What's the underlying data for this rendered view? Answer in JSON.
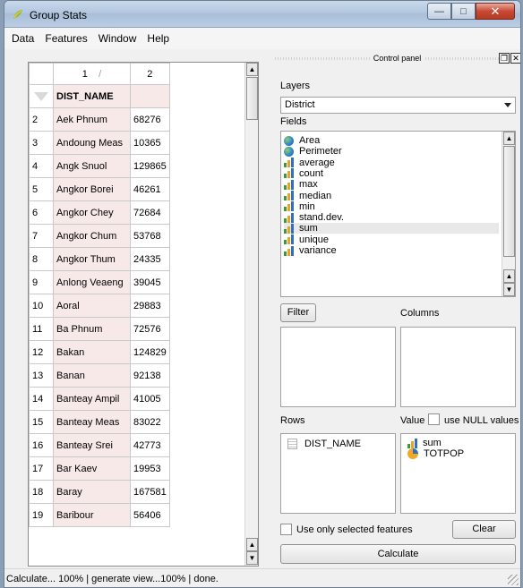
{
  "window": {
    "title": "Group Stats"
  },
  "menu": [
    "Data",
    "Features",
    "Window",
    "Help"
  ],
  "table": {
    "col_headers": [
      "1",
      "2"
    ],
    "field_header": "DIST_NAME",
    "rows": [
      {
        "n": "2",
        "name": "Aek Phnum",
        "value": "68276"
      },
      {
        "n": "3",
        "name": "Andoung Meas",
        "value": "10365"
      },
      {
        "n": "4",
        "name": "Angk Snuol",
        "value": "129865"
      },
      {
        "n": "5",
        "name": "Angkor Borei",
        "value": "46261"
      },
      {
        "n": "6",
        "name": "Angkor Chey",
        "value": "72684"
      },
      {
        "n": "7",
        "name": "Angkor Chum",
        "value": "53768"
      },
      {
        "n": "8",
        "name": "Angkor Thum",
        "value": "24335"
      },
      {
        "n": "9",
        "name": "Anlong Veaeng",
        "value": "39045"
      },
      {
        "n": "10",
        "name": "Aoral",
        "value": "29883"
      },
      {
        "n": "11",
        "name": "Ba Phnum",
        "value": "72576"
      },
      {
        "n": "12",
        "name": "Bakan",
        "value": "124829"
      },
      {
        "n": "13",
        "name": "Banan",
        "value": "92138"
      },
      {
        "n": "14",
        "name": "Banteay Ampil",
        "value": "41005"
      },
      {
        "n": "15",
        "name": "Banteay Meas",
        "value": "83022"
      },
      {
        "n": "16",
        "name": "Banteay Srei",
        "value": "42773"
      },
      {
        "n": "17",
        "name": "Bar Kaev",
        "value": "19953"
      },
      {
        "n": "18",
        "name": "Baray",
        "value": "167581"
      },
      {
        "n": "19",
        "name": "Baribour",
        "value": "56406"
      }
    ]
  },
  "panel": {
    "title": "Control panel",
    "layers_label": "Layers",
    "layer_value": "District",
    "fields_label": "Fields",
    "fields": [
      {
        "label": "Area",
        "icon": "globe"
      },
      {
        "label": "Perimeter",
        "icon": "globe"
      },
      {
        "label": "average",
        "icon": "bars"
      },
      {
        "label": "count",
        "icon": "bars"
      },
      {
        "label": "max",
        "icon": "bars"
      },
      {
        "label": "median",
        "icon": "bars"
      },
      {
        "label": "min",
        "icon": "bars"
      },
      {
        "label": "stand.dev.",
        "icon": "bars"
      },
      {
        "label": "sum",
        "icon": "bars",
        "selected": true
      },
      {
        "label": "unique",
        "icon": "bars"
      },
      {
        "label": "variance",
        "icon": "bars"
      }
    ],
    "filter_label": "Filter",
    "columns_label": "Columns",
    "rows_label": "Rows",
    "value_label": "Value",
    "null_label": "use NULL values",
    "rows_items": [
      "DIST_NAME"
    ],
    "value_items": [
      {
        "label": "sum",
        "icon": "bars"
      },
      {
        "label": "TOTPOP",
        "icon": "pie"
      }
    ],
    "selected_only_label": "Use only selected features",
    "clear_label": "Clear",
    "calculate_label": "Calculate"
  },
  "status": "Calculate... 100% |  generate view...100% |  done.",
  "colors": {
    "field_cell": "#f8e9e9",
    "accent": "#2f6fc4"
  }
}
